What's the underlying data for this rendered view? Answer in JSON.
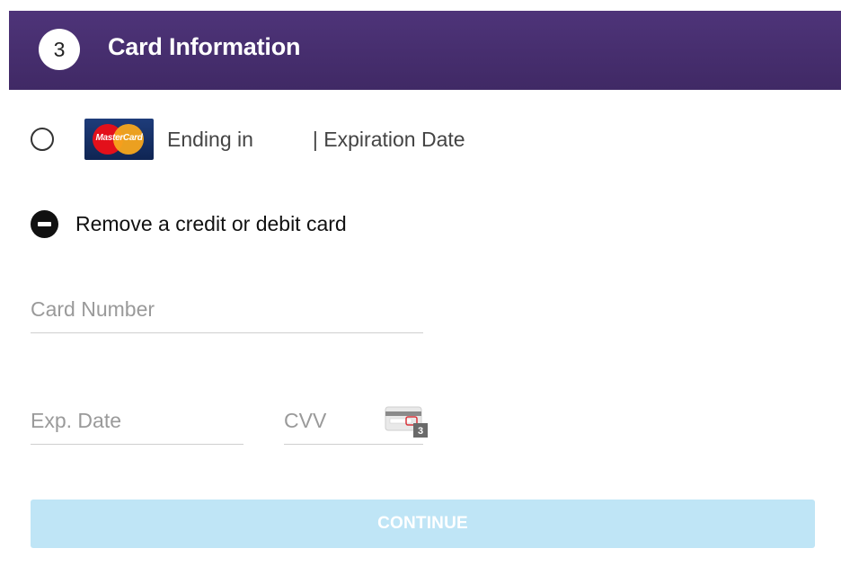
{
  "header": {
    "step_number": "3",
    "title": "Card Information"
  },
  "saved_card": {
    "brand_logo_text": "MasterCard",
    "ending_label": "Ending in",
    "expiration_label": "| Expiration Date"
  },
  "remove_action": {
    "icon": "minus-circle-icon",
    "label": "Remove a credit or debit card"
  },
  "form": {
    "card_number_placeholder": "Card Number",
    "exp_date_placeholder": "Exp. Date",
    "cvv_placeholder": "CVV",
    "cvv_hint_digit": "3"
  },
  "continue_label": "CONTINUE",
  "colors": {
    "header_bg": "#4e3479",
    "continue_bg": "#bfe5f6",
    "mastercard_red": "#e3101b",
    "mastercard_orange": "#f7a61c"
  }
}
